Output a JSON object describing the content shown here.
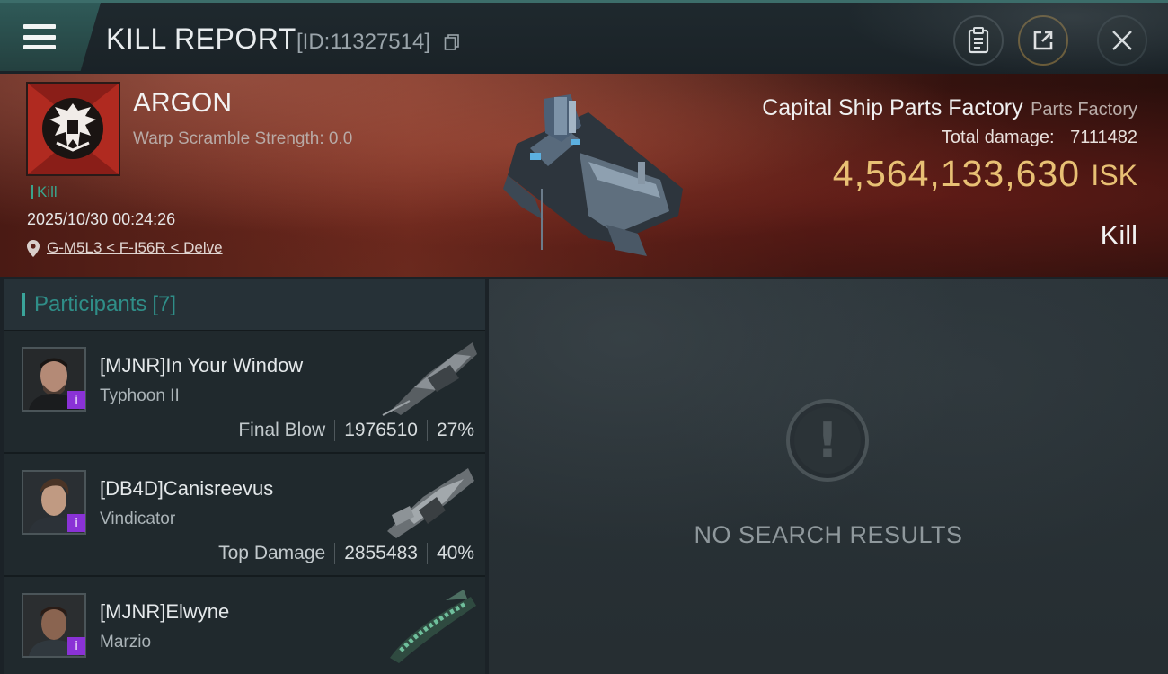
{
  "header": {
    "title": "KILL REPORT",
    "report_id": "[ID:11327514]",
    "icons": [
      "menu-icon",
      "copy-icon",
      "clipboard-icon",
      "share-icon",
      "close-icon"
    ]
  },
  "victim": {
    "name": "ARGON",
    "warp_scramble": "Warp Scramble Strength: 0.0",
    "kill_tag": "Kill",
    "datetime": "2025/10/30 00:24:26",
    "location": "G-M5L3 < F-I56R < Delve"
  },
  "target": {
    "name": "Capital Ship Parts Factory",
    "type": "Parts Factory",
    "total_damage_label": "Total damage:",
    "total_damage": "7111482",
    "isk_value": "4,564,133,630",
    "isk_unit": "ISK",
    "result": "Kill"
  },
  "participants": {
    "label": "Participants",
    "count": "[7]",
    "rows": [
      {
        "name": "[MJNR]In Your Window",
        "ship": "Typhoon II",
        "tag": "Final Blow",
        "damage": "1976510",
        "percent": "27%"
      },
      {
        "name": "[DB4D]Canisreevus",
        "ship": "Vindicator",
        "tag": "Top Damage",
        "damage": "2855483",
        "percent": "40%"
      },
      {
        "name": "[MJNR]Elwyne",
        "ship": "Marzio",
        "tag": "",
        "damage": "",
        "percent": ""
      }
    ]
  },
  "results": {
    "empty_text": "NO SEARCH RESULTS"
  },
  "colors": {
    "accent": "#3aa49a",
    "isk": "#e8c074",
    "badge": "#8a32d6"
  }
}
